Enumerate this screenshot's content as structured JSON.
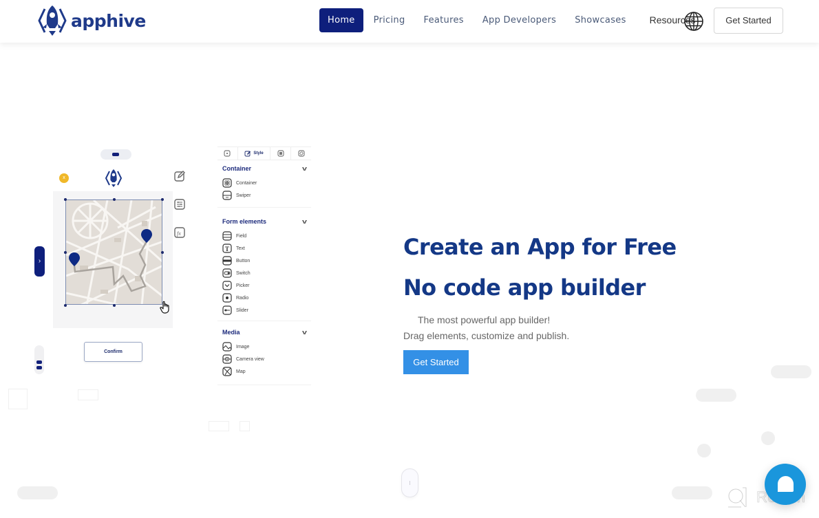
{
  "header": {
    "logo_text": "apphive",
    "nav": [
      {
        "label": "Home",
        "active": true
      },
      {
        "label": "Pricing",
        "active": false
      },
      {
        "label": "Features",
        "active": false
      },
      {
        "label": "App Developers",
        "active": false
      },
      {
        "label": "Showcases",
        "active": false
      },
      {
        "label": "Resources",
        "active": false
      }
    ],
    "language_icon": "globe-icon",
    "cta_label": "Get Started"
  },
  "builder_mock": {
    "close_label": "x",
    "side_tools": [
      "edit-icon",
      "styles-icon",
      "function-icon"
    ],
    "confirm_label": "Confirm",
    "nav_tab_glyph": "›",
    "panel": {
      "tabs": [
        {
          "icon": "component-icon",
          "label": ""
        },
        {
          "icon": "edit-style-icon",
          "label": "Style"
        },
        {
          "icon": "layout-icon",
          "label": ""
        },
        {
          "icon": "logic-icon",
          "label": ""
        }
      ],
      "sections": [
        {
          "title": "Container",
          "items": [
            "Container",
            "Swiper"
          ]
        },
        {
          "title": "Form elements",
          "items": [
            "Field",
            "Text",
            "Button",
            "Switch",
            "Picker",
            "Radio",
            "Slider"
          ]
        },
        {
          "title": "Media",
          "items": [
            "Image",
            "Camera view",
            "Map"
          ]
        }
      ]
    }
  },
  "hero": {
    "title_line1": "Create an App for Free",
    "title_line2": "No code app builder",
    "subtitle_line1": "The most powerful app builder!",
    "subtitle_line2": "Drag elements, customize and publish.",
    "cta_label": "Get Started"
  },
  "watermark": {
    "text": "Revain"
  },
  "colors": {
    "brand_navy": "#0e1f7c",
    "heading_blue": "#143886",
    "cta_blue": "#3390e6",
    "chat_blue": "#1a96dc",
    "close_yellow": "#f0b829"
  }
}
